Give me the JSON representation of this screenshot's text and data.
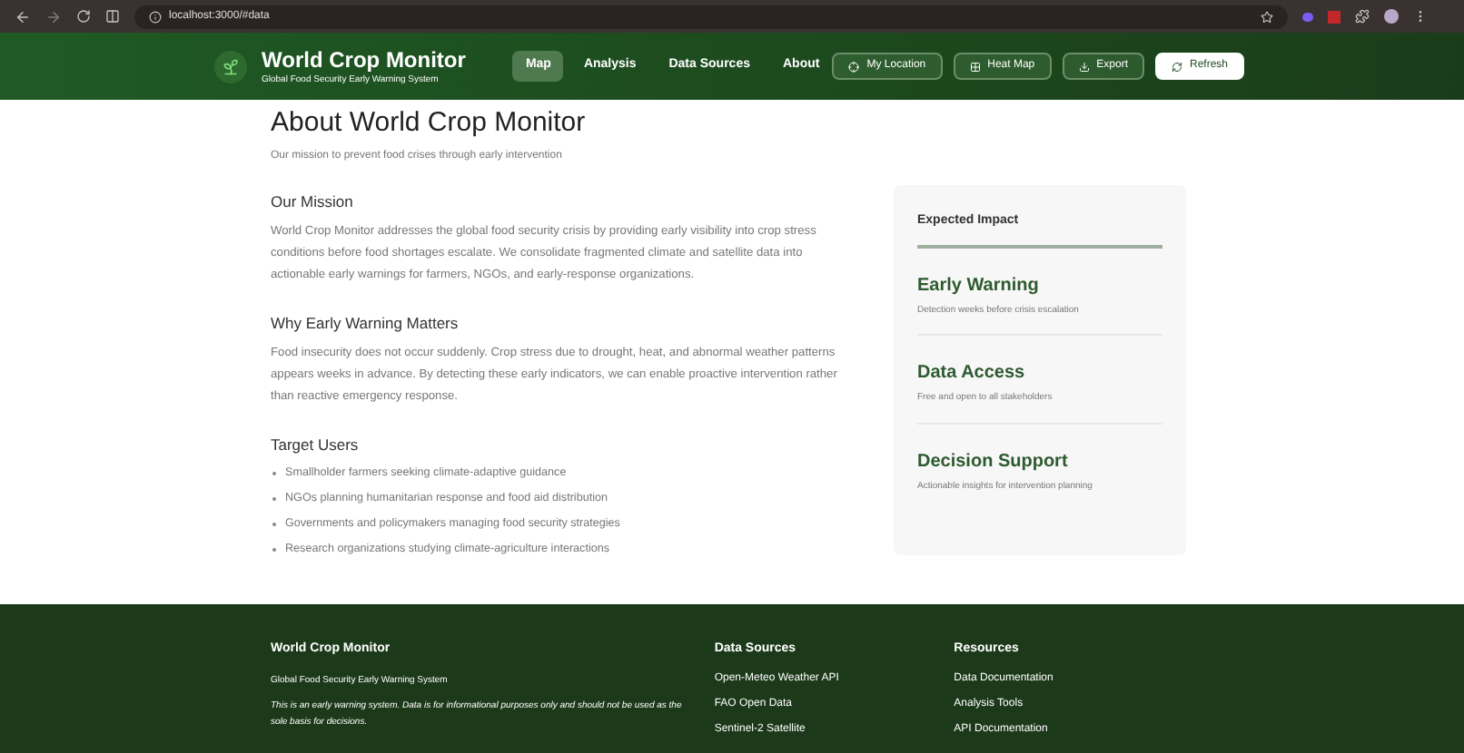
{
  "browser": {
    "url": "localhost:3000/#data"
  },
  "header": {
    "title": "World Crop Monitor",
    "subtitle": "Global Food Security Early Warning System",
    "nav": [
      {
        "label": "Map",
        "selected": true
      },
      {
        "label": "Analysis",
        "selected": false
      },
      {
        "label": "Data Sources",
        "selected": false
      },
      {
        "label": "About",
        "selected": false
      }
    ],
    "actions": [
      {
        "label": "My Location",
        "kind": "location",
        "primary": false
      },
      {
        "label": "Heat Map",
        "kind": "heatmap",
        "primary": false
      },
      {
        "label": "Export",
        "kind": "export",
        "primary": false
      },
      {
        "label": "Refresh",
        "kind": "refresh",
        "primary": true
      }
    ]
  },
  "about": {
    "title": "About World Crop Monitor",
    "subtitle": "Our mission to prevent food crises through early intervention",
    "sections": [
      {
        "heading": "Our Mission",
        "text": "World Crop Monitor addresses the global food security crisis by providing early visibility into crop stress conditions before food shortages escalate. We consolidate fragmented climate and satellite data into actionable early warnings for farmers, NGOs, and early-response organizations."
      },
      {
        "heading": "Why Early Warning Matters",
        "text": "Food insecurity does not occur suddenly. Crop stress due to drought, heat, and abnormal weather patterns appears weeks in advance. By detecting these early indicators, we can enable proactive intervention rather than reactive emergency response."
      },
      {
        "heading": "Target Users",
        "items": [
          "Smallholder farmers seeking climate-adaptive guidance",
          "NGOs planning humanitarian response and food aid distribution",
          "Governments and policymakers managing food security strategies",
          "Research organizations studying climate-agriculture interactions"
        ]
      }
    ],
    "impact": {
      "title": "Expected Impact",
      "items": [
        {
          "title": "Early Warning",
          "text": "Detection weeks before crisis escalation"
        },
        {
          "title": "Data Access",
          "text": "Free and open to all stakeholders"
        },
        {
          "title": "Decision Support",
          "text": "Actionable insights for intervention planning"
        }
      ]
    }
  },
  "footer": {
    "title": "World Crop Monitor",
    "subtitle": "Global Food Security Early Warning System",
    "disclaimer": "This is an early warning system. Data is for informational purposes only and should not be used as the sole basis for decisions.",
    "columns": [
      {
        "heading": "Data Sources",
        "links": [
          "Open-Meteo Weather API",
          "FAO Open Data",
          "Sentinel-2 Satellite"
        ]
      },
      {
        "heading": "Resources",
        "links": [
          "Data Documentation",
          "Analysis Tools",
          "API Documentation"
        ]
      }
    ]
  }
}
